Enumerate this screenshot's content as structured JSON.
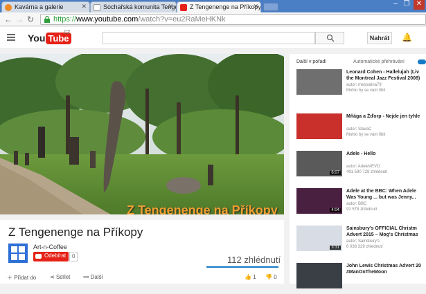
{
  "browser": {
    "tabs": [
      {
        "title": "Kavárna a galerie"
      },
      {
        "title": "Sochařská komunita Tengene"
      },
      {
        "title": "Z Tengenenge na Příkopy"
      }
    ],
    "url_scheme": "https://",
    "url_host": "www.youtube.com",
    "url_path": "/watch?v=eu2RaMeHKNk"
  },
  "youtube": {
    "logo_you": "You",
    "logo_tube": "Tube",
    "region": "CZ",
    "upload_label": "Nahrát"
  },
  "video": {
    "overlay_title": "Z Tengenenge na Příkopy",
    "title": "Z Tengenenge na Příkopy",
    "channel": "Art-n-Coffee",
    "subscribe_label": "Odebírat",
    "subscribers": "0",
    "views": "112 zhlédnutí",
    "actions": {
      "add_to": "Přidat do",
      "share": "Sdílet",
      "more": "Další",
      "likes": "1",
      "dislikes": "0"
    }
  },
  "sidebar": {
    "heading": "Další v pořadí",
    "autoplay_label": "Automatické přehrávání",
    "items": [
      {
        "title": "Leonard Cohen - Hallelujah (Liv",
        "title2": "the Montreal Jazz Festival 2008)",
        "author": "autor: messalina79",
        "views": "Mohlo by se vám líbit",
        "duration": "",
        "color": "#6f6f6f"
      },
      {
        "title": "Mňága a Žďorp - Nejde jen tyhle",
        "title2": "",
        "author": "autor: SlavaC",
        "views": "Mohlo by se vám líbit",
        "duration": "",
        "color": "#c9302c"
      },
      {
        "title": "Adele - Hello",
        "title2": "",
        "author": "autor: AdeleVEVO",
        "views": "491 590 729 zhlédnutí",
        "duration": "6:07",
        "color": "#5a5a5a"
      },
      {
        "title": "Adele at the BBC: When Adele",
        "title2": "Was Young ... but was Jenny...",
        "author": "autor: BBC",
        "views": "91 578 zhlédnutí",
        "duration": "4:04",
        "color": "#4a2040"
      },
      {
        "title": "Sainsbury's OFFICIAL Christm",
        "title2": "Advert 2015 – Mog's Christmas",
        "author": "autor: Sainsbury's",
        "views": "6 038 329 zhlédnutí",
        "duration": "3:31",
        "color": "#d8dde5"
      },
      {
        "title": "John Lewis Christmas Advert 20",
        "title2": "#ManOnTheMoon",
        "author": "",
        "views": "",
        "duration": "",
        "color": "#3a3f46"
      }
    ]
  }
}
